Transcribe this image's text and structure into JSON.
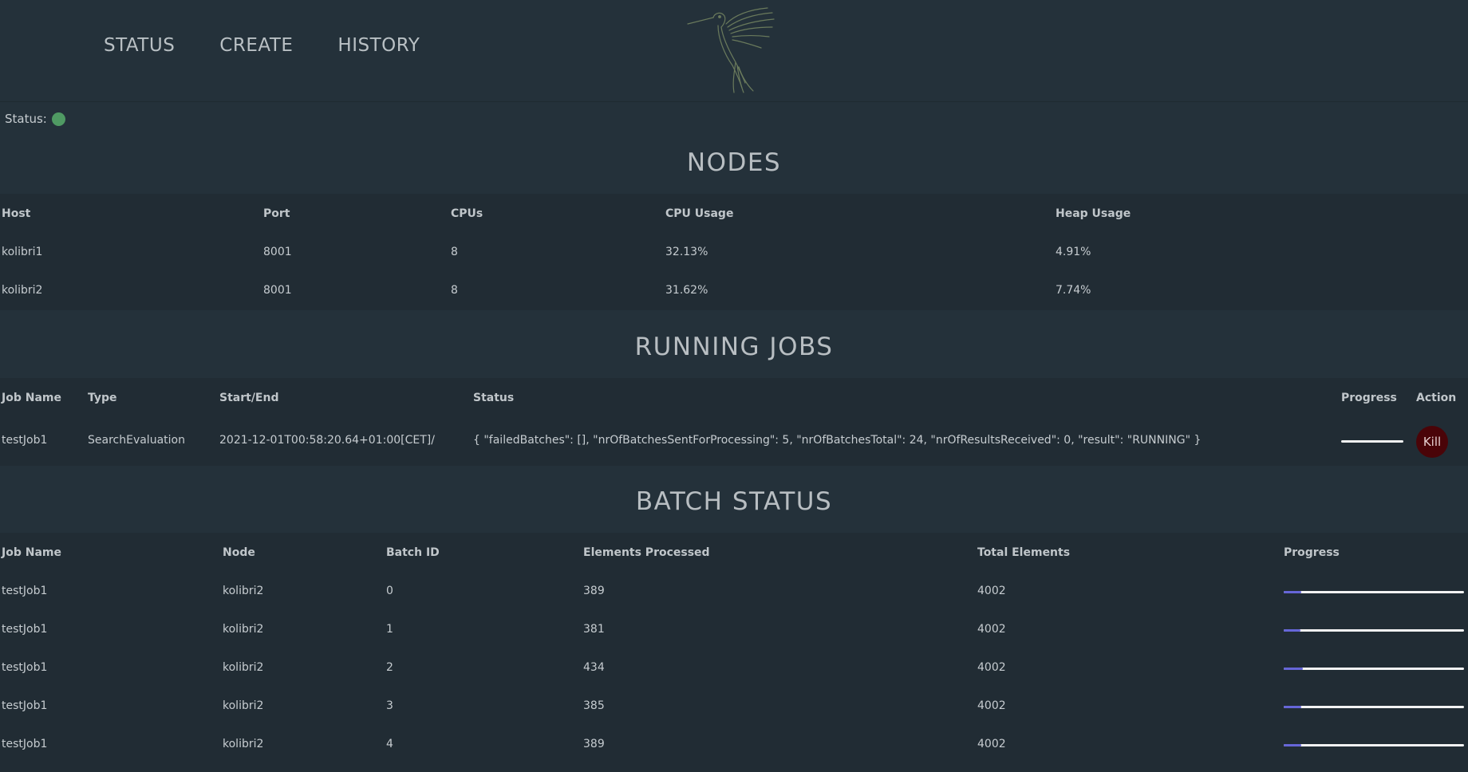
{
  "nav": {
    "items": [
      {
        "label": "STATUS"
      },
      {
        "label": "CREATE"
      },
      {
        "label": "HISTORY"
      }
    ]
  },
  "status": {
    "label": "Status:",
    "indicator_color": "#4f9a63"
  },
  "nodes": {
    "title": "NODES",
    "headers": [
      "Host",
      "Port",
      "CPUs",
      "CPU Usage",
      "Heap Usage"
    ],
    "rows": [
      [
        "kolibri1",
        "8001",
        "8",
        "32.13%",
        "4.91%"
      ],
      [
        "kolibri2",
        "8001",
        "8",
        "31.62%",
        "7.74%"
      ]
    ]
  },
  "running_jobs": {
    "title": "RUNNING JOBS",
    "headers": [
      "Job Name",
      "Type",
      "Start/End",
      "Status",
      "Progress",
      "Action"
    ],
    "rows": [
      {
        "job_name": "testJob1",
        "type": "SearchEvaluation",
        "start_end": "2021-12-01T00:58:20.64+01:00[CET]/",
        "status": "{ \"failedBatches\": [], \"nrOfBatchesSentForProcessing\": 5, \"nrOfBatchesTotal\": 24, \"nrOfResultsReceived\": 0, \"result\": \"RUNNING\" }",
        "progress": 0,
        "action": "Kill"
      }
    ]
  },
  "batch_status": {
    "title": "BATCH STATUS",
    "headers": [
      "Job Name",
      "Node",
      "Batch ID",
      "Elements Processed",
      "Total Elements",
      "Progress"
    ],
    "rows": [
      {
        "job_name": "testJob1",
        "node": "kolibri2",
        "batch_id": "0",
        "processed": "389",
        "total": "4002",
        "progress": 0.097
      },
      {
        "job_name": "testJob1",
        "node": "kolibri2",
        "batch_id": "1",
        "processed": "381",
        "total": "4002",
        "progress": 0.095
      },
      {
        "job_name": "testJob1",
        "node": "kolibri2",
        "batch_id": "2",
        "processed": "434",
        "total": "4002",
        "progress": 0.108
      },
      {
        "job_name": "testJob1",
        "node": "kolibri2",
        "batch_id": "3",
        "processed": "385",
        "total": "4002",
        "progress": 0.096
      },
      {
        "job_name": "testJob1",
        "node": "kolibri2",
        "batch_id": "4",
        "processed": "389",
        "total": "4002",
        "progress": 0.097
      }
    ]
  },
  "colors": {
    "background": "#24313a",
    "table_background": "#212c34",
    "progress_fill": "#6666d8",
    "kill_button": "#4a0408"
  }
}
